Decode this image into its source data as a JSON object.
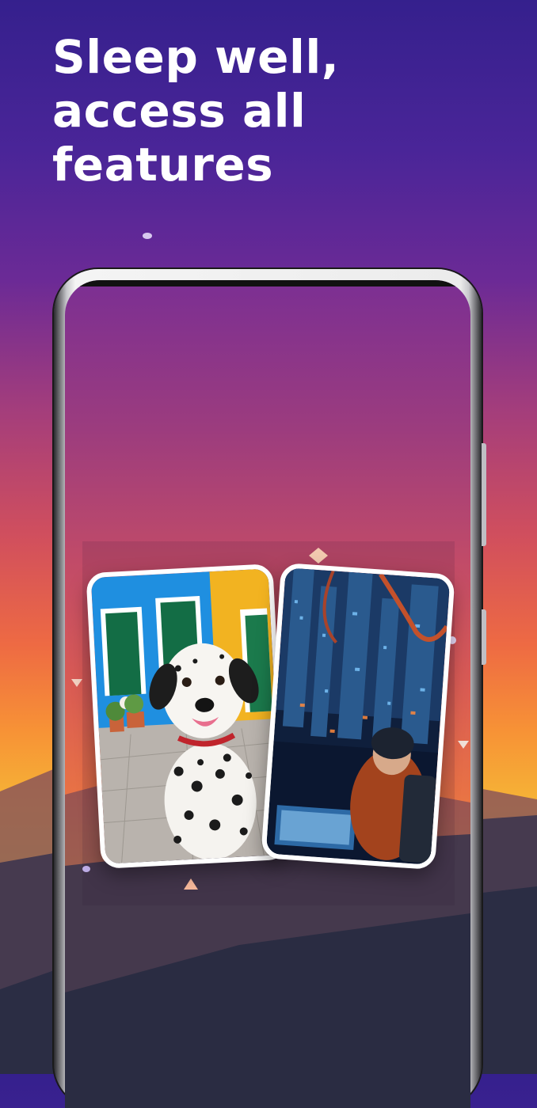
{
  "headline": {
    "line1": "Sleep well,",
    "line2": "access all features"
  },
  "colors": {
    "headline": "#ffffff",
    "sky_top": "#35208d",
    "sky_mid": "#d14f5d",
    "sky_glow": "#f6b536",
    "ground": "#2e3150"
  },
  "illustration": {
    "cards": [
      {
        "subject": "dalmatian-dog-photo"
      },
      {
        "subject": "cyberpunk-hacker-photo"
      }
    ]
  }
}
